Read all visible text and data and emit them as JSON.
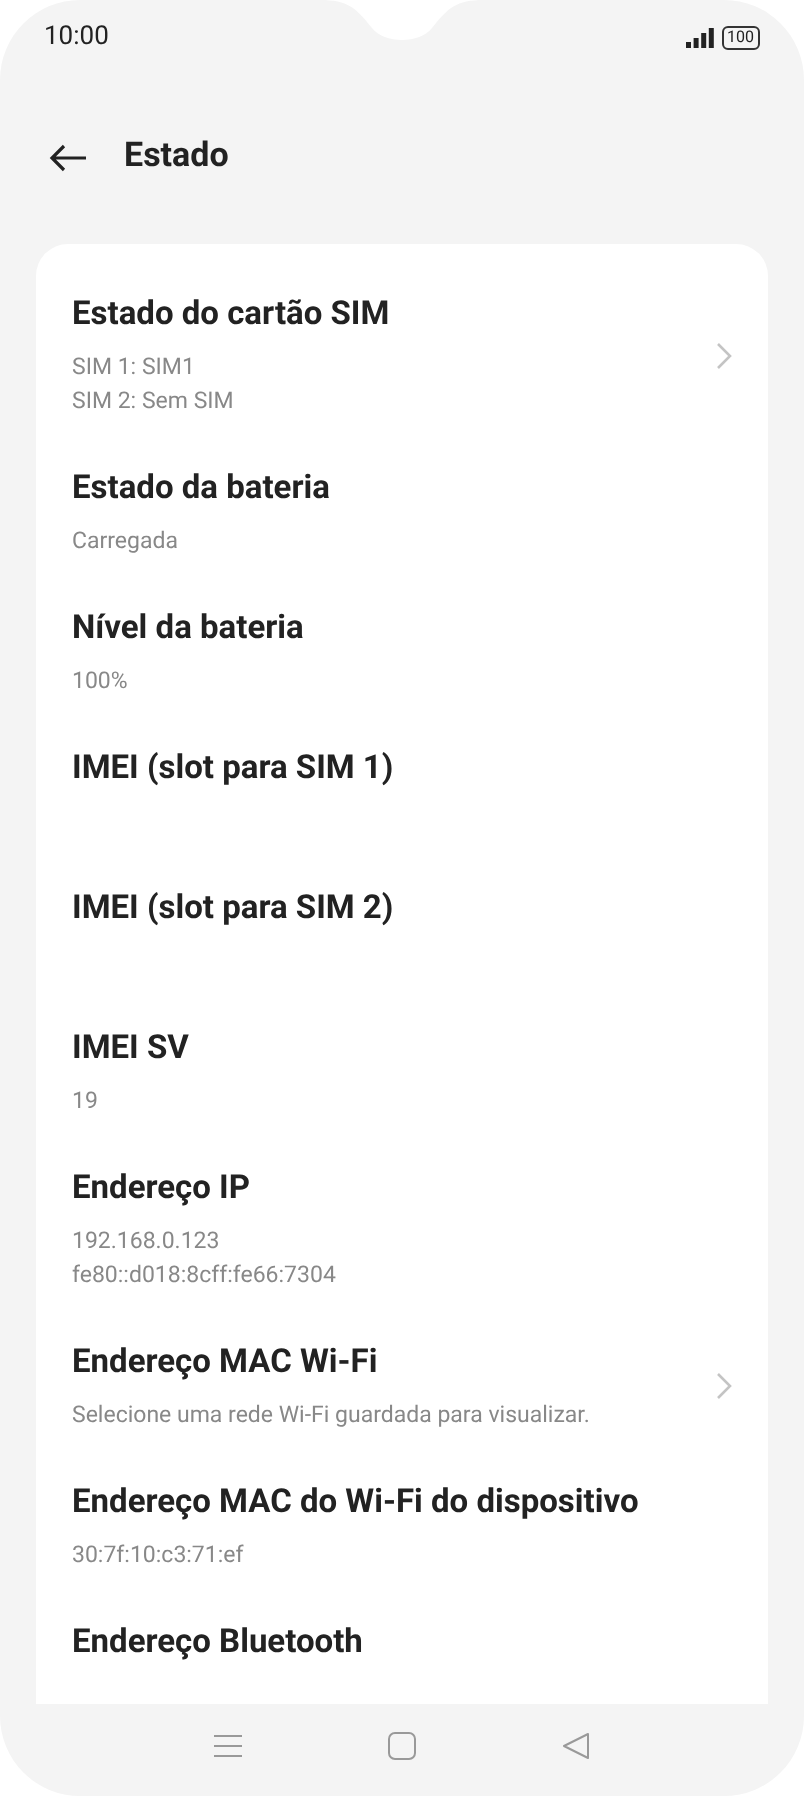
{
  "status_bar": {
    "time": "10:00",
    "battery": "100"
  },
  "header": {
    "title": "Estado"
  },
  "items": [
    {
      "kind": "link",
      "title": "Estado do cartão SIM",
      "values": [
        "SIM 1: SIM1",
        "SIM 2: Sem SIM"
      ]
    },
    {
      "kind": "info",
      "title": "Estado da bateria",
      "values": [
        "Carregada"
      ]
    },
    {
      "kind": "info",
      "title": "Nível da bateria",
      "values": [
        "100%"
      ]
    },
    {
      "kind": "info",
      "title": "IMEI (slot para SIM 1)"
    },
    {
      "kind": "info",
      "title": "IMEI (slot para SIM 2)"
    },
    {
      "kind": "info",
      "title": "IMEI SV",
      "values": [
        "19"
      ]
    },
    {
      "kind": "info",
      "title": "Endereço IP",
      "values": [
        "192.168.0.123",
        "fe80::d018:8cff:fe66:7304"
      ]
    },
    {
      "kind": "link",
      "title": "Endereço MAC Wi-Fi",
      "values": [
        "Selecione uma rede Wi-Fi guardada para visualizar."
      ]
    },
    {
      "kind": "info",
      "title": "Endereço MAC do Wi-Fi do dispositivo",
      "values": [
        "30:7f:10:c3:71:ef"
      ]
    },
    {
      "kind": "info",
      "title": "Endereço Bluetooth"
    }
  ]
}
